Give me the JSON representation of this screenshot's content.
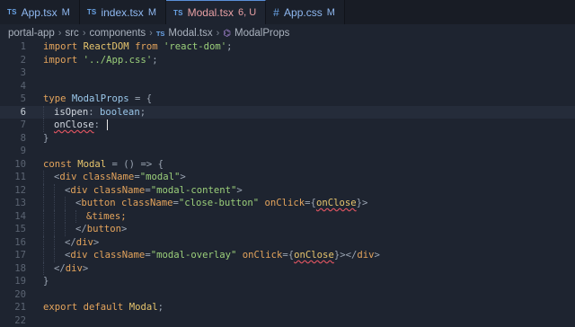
{
  "tabs": [
    {
      "icon": "TS",
      "name": "App.tsx",
      "status": "M",
      "active": false
    },
    {
      "icon": "TS",
      "name": "index.tsx",
      "status": "M",
      "active": false
    },
    {
      "icon": "TS",
      "name": "Modal.tsx",
      "status": "6, U",
      "active": true
    },
    {
      "icon": "#",
      "name": "App.css",
      "status": "M",
      "active": false
    }
  ],
  "breadcrumb": {
    "parts": [
      "portal-app",
      "src",
      "components"
    ],
    "file_icon": "TS",
    "file": "Modal.tsx",
    "symbol_icon": "⌬",
    "symbol": "ModalProps"
  },
  "editor": {
    "current_line": 6,
    "line_numbers": [
      "1",
      "2",
      "3",
      "4",
      "5",
      "6",
      "7",
      "8",
      "9",
      "10",
      "11",
      "12",
      "13",
      "14",
      "15",
      "16",
      "17",
      "18",
      "19",
      "20",
      "21",
      "22"
    ],
    "lines": [
      [
        {
          "t": "import ",
          "c": "kw"
        },
        {
          "t": "ReactDOM",
          "c": "fn"
        },
        {
          "t": " from ",
          "c": "kw"
        },
        {
          "t": "'react-dom'",
          "c": "str"
        },
        {
          "t": ";",
          "c": "punct"
        }
      ],
      [
        {
          "t": "import ",
          "c": "kw"
        },
        {
          "t": "'../App.css'",
          "c": "str"
        },
        {
          "t": ";",
          "c": "punct"
        }
      ],
      [],
      [],
      [
        {
          "t": "type ",
          "c": "kw"
        },
        {
          "t": "ModalProps",
          "c": "type"
        },
        {
          "t": " = {",
          "c": "punct"
        }
      ],
      [
        {
          "g": 1
        },
        {
          "t": "isOpen",
          "c": "prop"
        },
        {
          "t": ": ",
          "c": "punct"
        },
        {
          "t": "boolean",
          "c": "type"
        },
        {
          "t": ";",
          "c": "punct"
        }
      ],
      [
        {
          "g": 1
        },
        {
          "t": "onClose",
          "c": "prop err"
        },
        {
          "t": ": ",
          "c": "punct"
        },
        {
          "cursor": 1
        }
      ],
      [
        {
          "t": "}",
          "c": "punct"
        }
      ],
      [],
      [
        {
          "t": "const ",
          "c": "kw"
        },
        {
          "t": "Modal",
          "c": "fn"
        },
        {
          "t": " = () => {",
          "c": "punct"
        }
      ],
      [
        {
          "g": 1
        },
        {
          "t": "<",
          "c": "punct"
        },
        {
          "t": "div",
          "c": "tag"
        },
        {
          "t": " className",
          "c": "attr"
        },
        {
          "t": "=",
          "c": "punct"
        },
        {
          "t": "\"modal\"",
          "c": "str"
        },
        {
          "t": ">",
          "c": "punct"
        }
      ],
      [
        {
          "g": 2
        },
        {
          "t": "<",
          "c": "punct"
        },
        {
          "t": "div",
          "c": "tag"
        },
        {
          "t": " className",
          "c": "attr"
        },
        {
          "t": "=",
          "c": "punct"
        },
        {
          "t": "\"modal-content\"",
          "c": "str"
        },
        {
          "t": ">",
          "c": "punct"
        }
      ],
      [
        {
          "g": 3
        },
        {
          "t": "<",
          "c": "punct"
        },
        {
          "t": "button",
          "c": "tag"
        },
        {
          "t": " className",
          "c": "attr"
        },
        {
          "t": "=",
          "c": "punct"
        },
        {
          "t": "\"close-button\"",
          "c": "str"
        },
        {
          "t": " onClick",
          "c": "attr"
        },
        {
          "t": "={",
          "c": "punct"
        },
        {
          "t": "onClose",
          "c": "fn err"
        },
        {
          "t": "}>",
          "c": "punct"
        }
      ],
      [
        {
          "g": 4
        },
        {
          "t": "&times;",
          "c": "ent"
        }
      ],
      [
        {
          "g": 3
        },
        {
          "t": "</",
          "c": "punct"
        },
        {
          "t": "button",
          "c": "tag"
        },
        {
          "t": ">",
          "c": "punct"
        }
      ],
      [
        {
          "g": 2
        },
        {
          "t": "</",
          "c": "punct"
        },
        {
          "t": "div",
          "c": "tag"
        },
        {
          "t": ">",
          "c": "punct"
        }
      ],
      [
        {
          "g": 2
        },
        {
          "t": "<",
          "c": "punct"
        },
        {
          "t": "div",
          "c": "tag"
        },
        {
          "t": " className",
          "c": "attr"
        },
        {
          "t": "=",
          "c": "punct"
        },
        {
          "t": "\"modal-overlay\"",
          "c": "str"
        },
        {
          "t": " onClick",
          "c": "attr"
        },
        {
          "t": "={",
          "c": "punct"
        },
        {
          "t": "onClose",
          "c": "fn err"
        },
        {
          "t": "}></",
          "c": "punct"
        },
        {
          "t": "div",
          "c": "tag"
        },
        {
          "t": ">",
          "c": "punct"
        }
      ],
      [
        {
          "g": 1
        },
        {
          "t": "</",
          "c": "punct"
        },
        {
          "t": "div",
          "c": "tag"
        },
        {
          "t": ">",
          "c": "punct"
        }
      ],
      [
        {
          "t": "}",
          "c": "punct"
        }
      ],
      [],
      [
        {
          "t": "export ",
          "c": "kw"
        },
        {
          "t": "default ",
          "c": "kw"
        },
        {
          "t": "Modal",
          "c": "fn"
        },
        {
          "t": ";",
          "c": "punct"
        }
      ],
      []
    ]
  }
}
